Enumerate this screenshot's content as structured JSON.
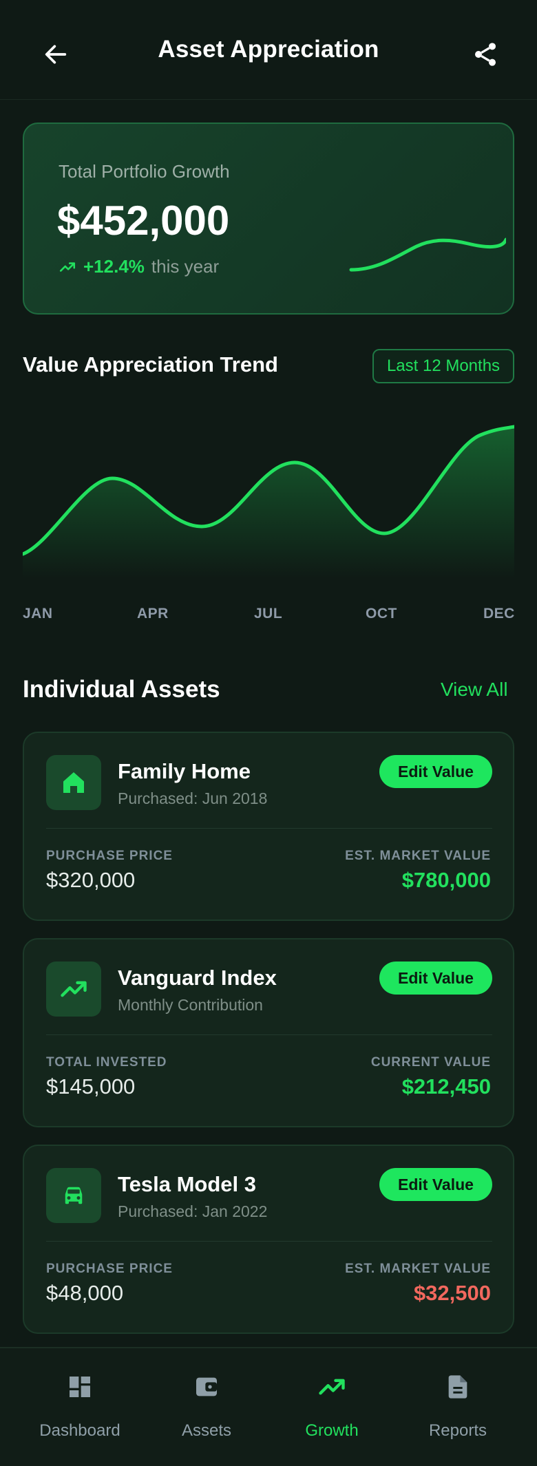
{
  "header": {
    "title": "Asset Appreciation",
    "back_icon": "arrow-left-icon",
    "share_icon": "share-icon"
  },
  "summary": {
    "label": "Total Portfolio Growth",
    "value": "$452,000",
    "change_pct": "+12.4%",
    "change_period": "this year",
    "trend_icon": "trending-up-icon"
  },
  "trend": {
    "title": "Value Appreciation Trend",
    "range": "Last 12 Months",
    "months": [
      "JAN",
      "APR",
      "JUL",
      "OCT",
      "DEC"
    ]
  },
  "assets": {
    "title": "Individual Assets",
    "view_all": "View All",
    "items": [
      {
        "icon": "home-icon",
        "name": "Family Home",
        "sub": "Purchased: Jun 2018",
        "edit": "Edit Value",
        "left_label": "PURCHASE PRICE",
        "left_value": "$320,000",
        "right_label": "EST. MARKET VALUE",
        "right_value": "$780,000",
        "right_color": "#22e05e"
      },
      {
        "icon": "trending-up-icon",
        "name": "Vanguard Index",
        "sub": "Monthly Contribution",
        "edit": "Edit Value",
        "left_label": "TOTAL INVESTED",
        "left_value": "$145,000",
        "right_label": "CURRENT VALUE",
        "right_value": "$212,450",
        "right_color": "#22e05e"
      },
      {
        "icon": "car-icon",
        "name": "Tesla Model 3",
        "sub": "Purchased: Jan 2022",
        "edit": "Edit Value",
        "left_label": "PURCHASE PRICE",
        "left_value": "$48,000",
        "right_label": "EST. MARKET VALUE",
        "right_value": "$32,500",
        "right_color": "#f2685e"
      }
    ]
  },
  "nav": {
    "items": [
      {
        "label": "Dashboard",
        "icon": "dashboard-icon",
        "active": false
      },
      {
        "label": "Assets",
        "icon": "wallet-icon",
        "active": false
      },
      {
        "label": "Growth",
        "icon": "trending-up-icon",
        "active": true
      },
      {
        "label": "Reports",
        "icon": "document-icon",
        "active": false
      }
    ]
  },
  "colors": {
    "accent": "#22e05e",
    "negative": "#f2685e",
    "background": "#0f1a15"
  }
}
